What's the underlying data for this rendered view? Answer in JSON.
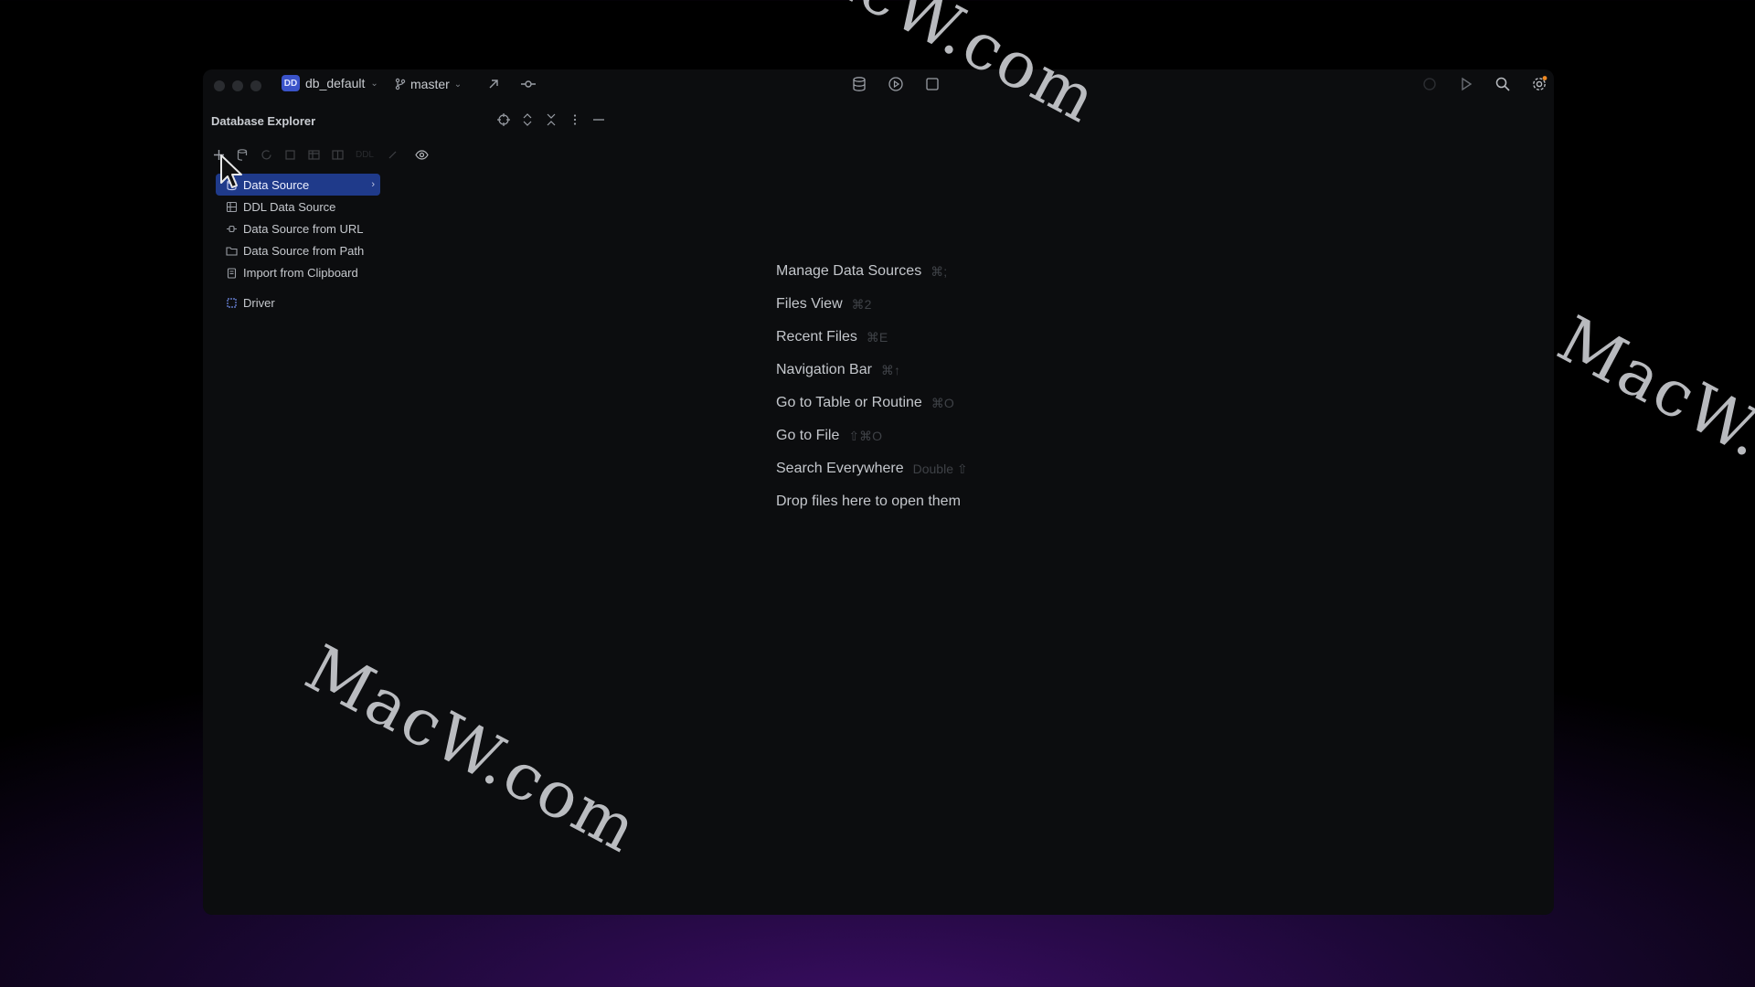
{
  "titlebar": {
    "project_initials": "DD",
    "project_name": "db_default",
    "branch": "master"
  },
  "panel": {
    "title": "Database Explorer"
  },
  "toolbar2": {
    "ddl_label": "DDL"
  },
  "menu": {
    "items": [
      {
        "label": "Data Source",
        "icon": "database-icon",
        "submenu": true,
        "selected": true
      },
      {
        "label": "DDL Data Source",
        "icon": "ddl-icon"
      },
      {
        "label": "Data Source from URL",
        "icon": "url-icon"
      },
      {
        "label": "Data Source from Path",
        "icon": "folder-icon"
      },
      {
        "label": "Import from Clipboard",
        "icon": "clipboard-icon"
      },
      {
        "label": "Driver",
        "icon": "driver-icon"
      }
    ]
  },
  "hints": [
    {
      "label": "Manage Data Sources",
      "shortcut": "⌘;"
    },
    {
      "label": "Files View",
      "shortcut": "⌘2"
    },
    {
      "label": "Recent Files",
      "shortcut": "⌘E"
    },
    {
      "label": "Navigation Bar",
      "shortcut": "⌘↑"
    },
    {
      "label": "Go to Table or Routine",
      "shortcut": "⌘O"
    },
    {
      "label": "Go to File",
      "shortcut": "⇧⌘O"
    },
    {
      "label": "Search Everywhere",
      "shortcut": "Double ⇧"
    },
    {
      "label": "Drop files here to open them",
      "shortcut": ""
    }
  ],
  "watermarks": [
    "MacW.com",
    "MacW.com",
    "MacW.c"
  ],
  "colors": {
    "accent": "#1f3a8a",
    "badge": "#3a53c9",
    "notify": "#f08a24"
  }
}
